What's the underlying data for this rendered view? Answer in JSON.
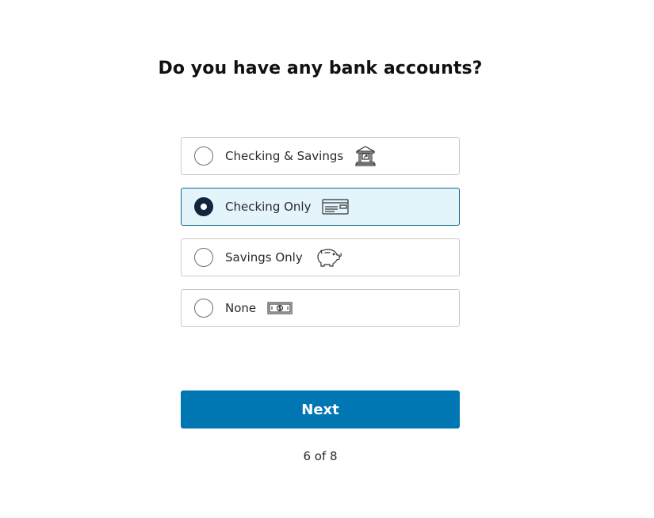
{
  "question": {
    "title": "Do you have any bank accounts?"
  },
  "options": [
    {
      "label": "Checking & Savings",
      "icon": "bank-building-icon",
      "selected": false
    },
    {
      "label": "Checking Only",
      "icon": "check-card-icon",
      "selected": true
    },
    {
      "label": "Savings Only",
      "icon": "piggy-bank-icon",
      "selected": false
    },
    {
      "label": "None",
      "icon": "cash-bill-icon",
      "selected": false
    }
  ],
  "actions": {
    "next_label": "Next"
  },
  "progress": {
    "text": "6 of 8",
    "current": 6,
    "total": 8
  },
  "colors": {
    "primary_button": "#0077b3",
    "selected_background": "#e3f4fb",
    "selected_border": "#0f6a8c",
    "selected_radio": "#13243d"
  }
}
